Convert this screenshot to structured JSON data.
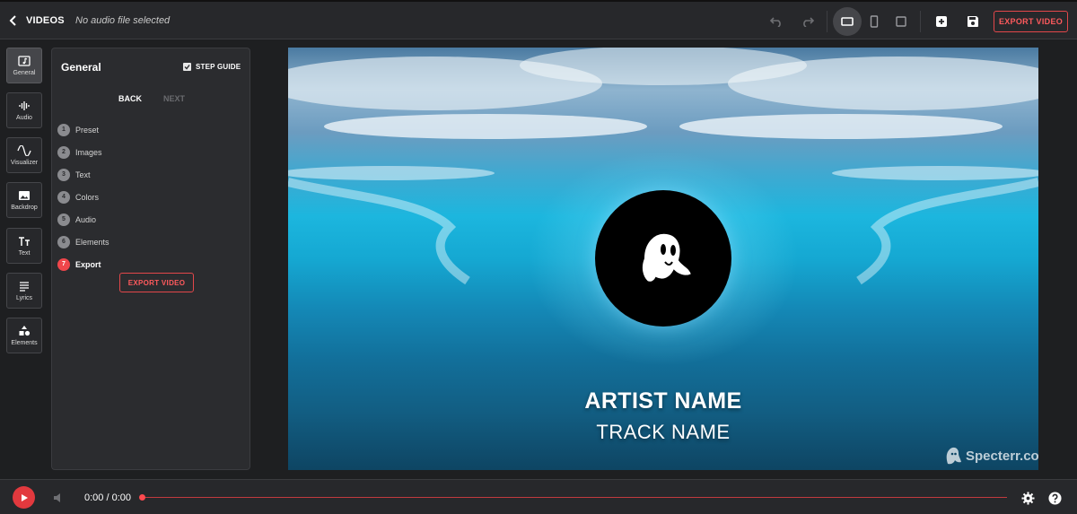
{
  "header": {
    "back_label": "VIDEOS",
    "audio_status": "No audio file selected",
    "export_label": "EXPORT VIDEO"
  },
  "toolbar_icons": [
    "undo-icon",
    "redo-icon",
    "landscape-ratio-icon",
    "portrait-ratio-icon",
    "square-ratio-icon",
    "add-project-icon",
    "save-icon"
  ],
  "rail": {
    "items": [
      {
        "label": "General",
        "icon": "music-file-icon",
        "active": true
      },
      {
        "label": "Audio",
        "icon": "waveform-icon",
        "active": false
      },
      {
        "label": "Visualizer",
        "icon": "wave-icon",
        "active": false
      },
      {
        "label": "Backdrop",
        "icon": "image-icon",
        "active": false
      },
      {
        "label": "Text",
        "icon": "text-icon",
        "active": false
      },
      {
        "label": "Lyrics",
        "icon": "lines-icon",
        "active": false
      },
      {
        "label": "Elements",
        "icon": "shapes-icon",
        "active": false
      }
    ]
  },
  "panel": {
    "title": "General",
    "step_guide_label": "STEP GUIDE",
    "step_guide_checked": true,
    "back_label": "BACK",
    "next_label": "NEXT",
    "steps": [
      {
        "num": "1",
        "label": "Preset"
      },
      {
        "num": "2",
        "label": "Images"
      },
      {
        "num": "3",
        "label": "Text"
      },
      {
        "num": "4",
        "label": "Colors"
      },
      {
        "num": "5",
        "label": "Audio"
      },
      {
        "num": "6",
        "label": "Elements"
      },
      {
        "num": "7",
        "label": "Export",
        "active": true
      }
    ],
    "export_label": "EXPORT VIDEO"
  },
  "preview": {
    "artist_name": "ARTIST NAME",
    "track_name": "TRACK NAME",
    "watermark": "Specterr.com"
  },
  "player": {
    "time": "0:00 / 0:00",
    "progress": 0
  },
  "colors": {
    "accent": "#e2393e",
    "background": "#1e1f21",
    "panel": "#2b2c2f"
  }
}
